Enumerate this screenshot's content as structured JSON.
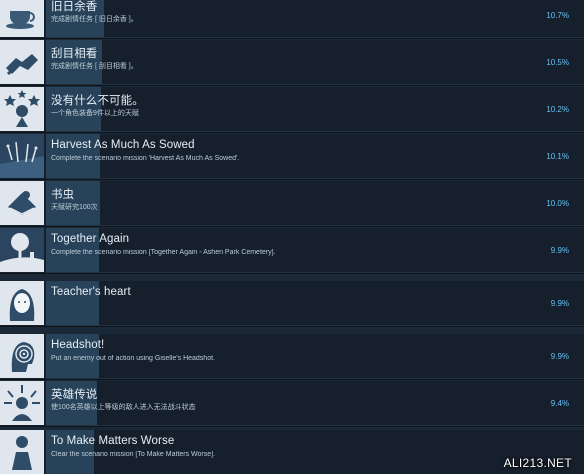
{
  "achievements": [
    {
      "title": "旧日余香",
      "desc": "完成剧情任务 [ 旧日余香 ]。",
      "percent": "10.7%",
      "fill": 0.107,
      "icon": "teacup-icon"
    },
    {
      "title": "刮目相看",
      "desc": "完成剧情任务 [ 刮目相看 ]。",
      "percent": "10.5%",
      "fill": 0.105,
      "icon": "handshake-icon"
    },
    {
      "title": "没有什么不可能。",
      "desc": "一个角色装备9件以上的天赋",
      "percent": "10.2%",
      "fill": 0.102,
      "icon": "star-burst-icon"
    },
    {
      "title": "Harvest As Much As Sowed",
      "desc": "Complete the scenario mission 'Harvest As Much As Sowed'.",
      "percent": "10.1%",
      "fill": 0.101,
      "icon": "field-icon"
    },
    {
      "title": "书虫",
      "desc": "天赋研究100次",
      "percent": "10.0%",
      "fill": 0.1,
      "icon": "book-icon"
    },
    {
      "title": "Together Again",
      "desc": "Complete the scenario mission [Together Again - Ashen Park Cemetery].",
      "percent": "9.9%",
      "fill": 0.099,
      "icon": "tree-icon"
    },
    {
      "title": "Teacher's heart",
      "desc": "",
      "percent": "9.9%",
      "fill": 0.099,
      "icon": "girl-portrait-icon"
    },
    {
      "title": "Headshot!",
      "desc": "Put an enemy out of action using Giselle's Headshot.",
      "percent": "9.9%",
      "fill": 0.099,
      "icon": "target-head-icon"
    },
    {
      "title": "英雄传说",
      "desc": "使100名英雄以上等级的敌人进入无法战斗状态",
      "percent": "9.4%",
      "fill": 0.094,
      "icon": "radiant-hero-icon"
    },
    {
      "title": "To Make Matters Worse",
      "desc": "Clear the scenario mission [To Make Matters Worse].",
      "percent": "",
      "fill": 0.09,
      "icon": "figure-icon"
    }
  ],
  "watermark": "ALI213.NET"
}
